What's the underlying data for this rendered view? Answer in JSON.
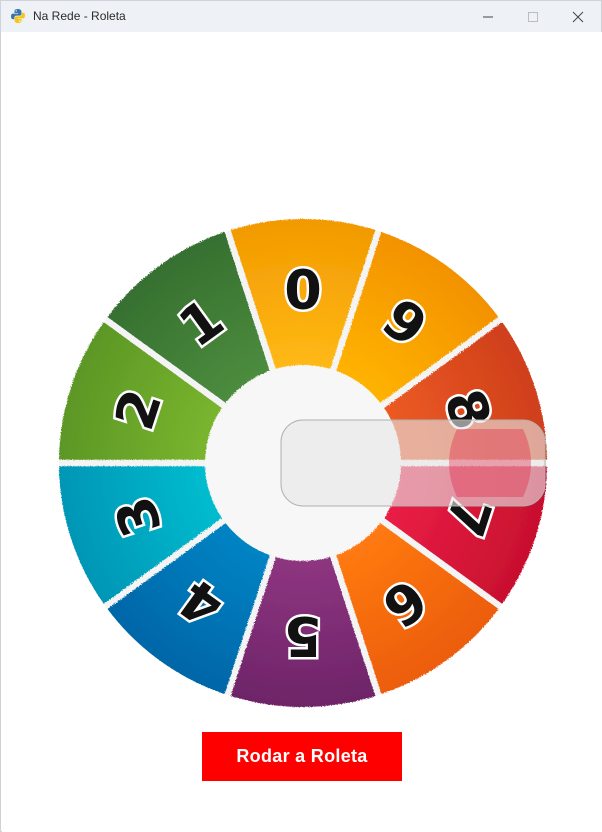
{
  "window": {
    "title": "Na Rede - Roleta",
    "app_icon": "python-icon"
  },
  "controls": {
    "minimize": "minimize-icon",
    "maximize": "maximize-icon",
    "close": "close-icon"
  },
  "wheel": {
    "segments": [
      {
        "label": "0",
        "color": "#ffb915",
        "shade": "#f29a00"
      },
      {
        "label": "9",
        "color": "#ffb300",
        "shade": "#f39200"
      },
      {
        "label": "8",
        "color": "#ec5a24",
        "shade": "#cf3f1b"
      },
      {
        "label": "7",
        "color": "#ea1e46",
        "shade": "#c8102e"
      },
      {
        "label": "6",
        "color": "#ff7a12",
        "shade": "#ec5d0b"
      },
      {
        "label": "5",
        "color": "#8e3580",
        "shade": "#6e2468"
      },
      {
        "label": "4",
        "color": "#0484c4",
        "shade": "#0266a8"
      },
      {
        "label": "3",
        "color": "#00bccf",
        "shade": "#0096b6"
      },
      {
        "label": "2",
        "color": "#7ab52e",
        "shade": "#5c9726"
      },
      {
        "label": "1",
        "color": "#4c8c3e",
        "shade": "#367030"
      }
    ],
    "selected": "7",
    "hub_color": "#f7f7f7",
    "pointer_color": "#e6e6e6"
  },
  "spin_button": {
    "label": "Rodar a Roleta",
    "color": "#ff0000"
  }
}
